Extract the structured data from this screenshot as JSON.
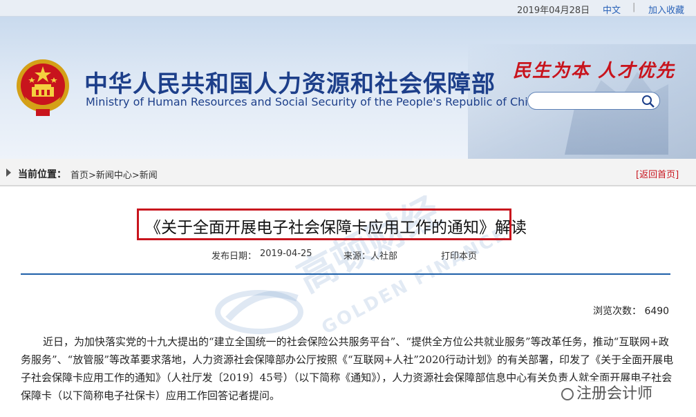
{
  "topbar": {
    "date": "2019年04月28日",
    "lang": "中文",
    "separator": "|",
    "favorite": "加入收藏"
  },
  "header": {
    "cn_title": "中华人民共和国人力资源和社会保障部",
    "en_title": "Ministry of Human Resources and Social Security of the People's Republic of China",
    "slogan": "民生为本 人才优先",
    "search_placeholder": ""
  },
  "breadcrumb": {
    "label": "当前位置：",
    "path": "首页>新闻中心>新闻",
    "back": "[返回首页]"
  },
  "article": {
    "title": "《关于全面开展电子社会保障卡应用工作的通知》解读",
    "date_label": "发布日期：",
    "date_value": "2019-04-25",
    "source": "来源：人社部",
    "print": "打印本页",
    "views": "浏览次数： 6490",
    "body": "近日，为加快落实党的十九大提出的“建立全国统一的社会保险公共服务平台”、“提供全方位公共就业服务”等改革任务，推动“互联网+政务服务”、“放管服”等改革要求落地，人力资源社会保障部办公厅按照《“互联网+人社”2020行动计划》的有关部署，印发了《关于全面开展电子社会保障卡应用工作的通知》（人社厅发〔2019〕45号）（以下简称《通知》），人力资源社会保障部信息中心有关负责人就全面开展电子社会保障卡（以下简称电子社保卡）应用工作回答记者提问。"
  },
  "watermark": {
    "cn": "高顿财经",
    "en": "GOLDEN FINANCE",
    "wechat": "注册会计师"
  },
  "colors": {
    "brand_blue": "#1d3f8a",
    "accent_red": "#c8141d",
    "link_blue": "#2a63b8"
  }
}
